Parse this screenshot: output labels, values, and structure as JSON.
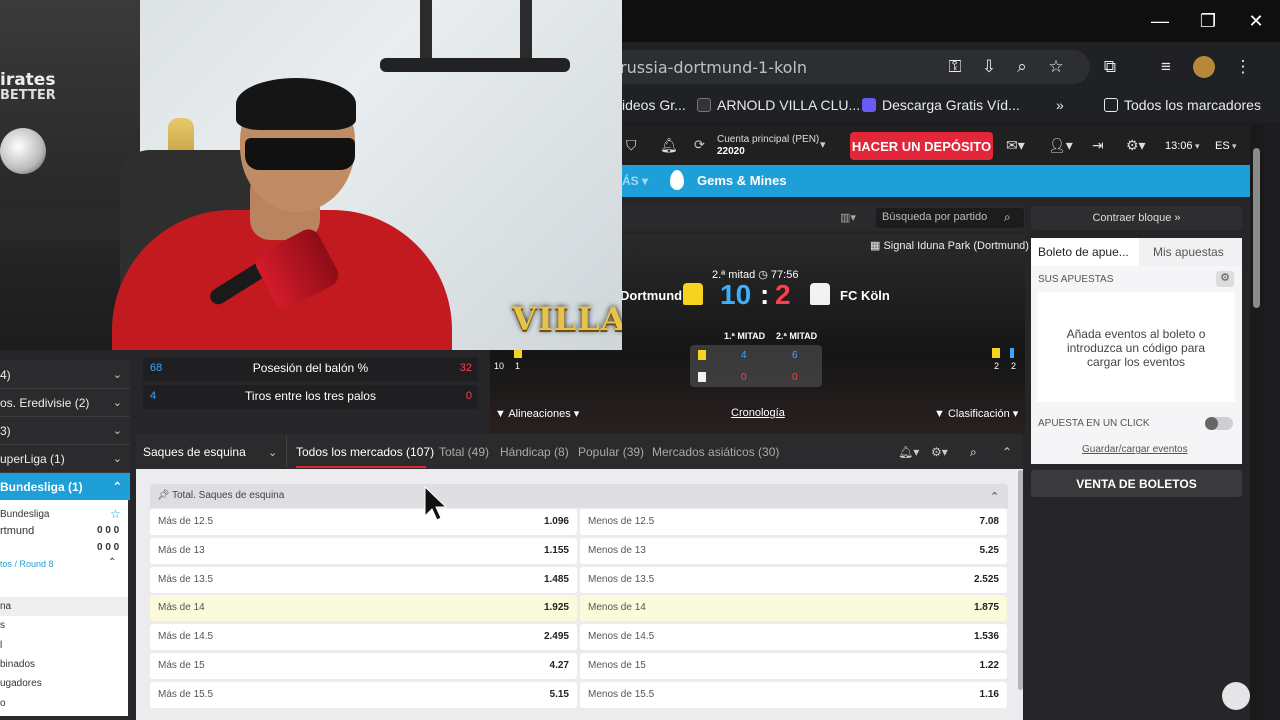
{
  "browser": {
    "url": "russia-dortmund-1-koln",
    "window_controls": [
      "—",
      "❐",
      "✕"
    ],
    "bookmarks": [
      {
        "label": "ideos Gr...",
        "color": "#888"
      },
      {
        "label": "ARNOLD VILLA CLU...",
        "color": "#444"
      },
      {
        "label": "Descarga Gratis Víd...",
        "color": "#6a5af9"
      }
    ],
    "bookmarks_overflow": "»",
    "all_bookmarks": "Todos los marcadores"
  },
  "webcam": {
    "logo": "VILLA",
    "shirt_text_1": "irates",
    "shirt_text_2": "BETTER"
  },
  "header": {
    "account_label": "Cuenta principal (PEN)",
    "account_value": "22020",
    "deposit_button": "HACER UN DEPÓSITO",
    "time": "13:06",
    "language": "ES"
  },
  "nav": {
    "more": "ÁS",
    "gems": "Gems & Mines"
  },
  "match": {
    "search_placeholder": "Búsqueda por partido",
    "stadium": "Signal Iduna Park (Dortmund)",
    "period": "2.ª mitad",
    "clock": "77:56",
    "home_team": "Dortmund",
    "away_team": "FC Köln",
    "home_score": "10",
    "separator": ":",
    "away_score": "2",
    "first_half_label": "1.ª MITAD",
    "second_half_label": "2.ª MITAD",
    "home_first_half": "4",
    "home_second_half": "6",
    "away_first_half": "0",
    "away_second_half": "0",
    "left_card_counts": [
      "10",
      "1"
    ],
    "right_card_counts": [
      "2",
      "2"
    ],
    "links": {
      "lineups": "Alineaciones",
      "timeline": "Cronología",
      "standings": "Clasificación"
    },
    "stats": [
      {
        "home": "68",
        "label": "Posesión del balón %",
        "away": "32"
      },
      {
        "home": "4",
        "label": "Tiros entre los tres palos",
        "away": "0"
      }
    ]
  },
  "sidebar": {
    "items": [
      {
        "label": "4)"
      },
      {
        "label": "os. Eredivisie (2)"
      },
      {
        "label": "3)"
      },
      {
        "label": "uperLiga (1)"
      },
      {
        "label": "Bundesliga (1)"
      }
    ],
    "league": "Bundesliga",
    "team1": "rtmund",
    "team1_score": "0 0 0",
    "team2_score": "0 0 0",
    "round": "tos / Round 8",
    "menu": [
      "na",
      "s",
      "l",
      "binados",
      "ugadores",
      "o"
    ]
  },
  "markets": {
    "selected": "Saques de esquina",
    "tabs": [
      {
        "label": "Todos los mercados (107)"
      },
      {
        "label": "Total (49)"
      },
      {
        "label": "Hándicap (8)"
      },
      {
        "label": "Popular (39)"
      },
      {
        "label": "Mercados asiáticos (30)"
      }
    ],
    "group_title": "Total. Saques de esquina",
    "rows": [
      {
        "over_label": "Más de 12.5",
        "over_odd": "1.096",
        "under_label": "Menos de 12.5",
        "under_odd": "7.08"
      },
      {
        "over_label": "Más de 13",
        "over_odd": "1.155",
        "under_label": "Menos de 13",
        "under_odd": "5.25"
      },
      {
        "over_label": "Más de 13.5",
        "over_odd": "1.485",
        "under_label": "Menos de 13.5",
        "under_odd": "2.525"
      },
      {
        "over_label": "Más de 14",
        "over_odd": "1.925",
        "under_label": "Menos de 14",
        "under_odd": "1.875"
      },
      {
        "over_label": "Más de 14.5",
        "over_odd": "2.495",
        "under_label": "Menos de 14.5",
        "under_odd": "1.536"
      },
      {
        "over_label": "Más de 15",
        "over_odd": "4.27",
        "under_label": "Menos de 15",
        "under_odd": "1.22"
      },
      {
        "over_label": "Más de 15.5",
        "over_odd": "5.15",
        "under_label": "Menos de 15.5",
        "under_odd": "1.16"
      }
    ]
  },
  "betslip": {
    "collapse_button": "Contraer bloque",
    "tab_slip": "Boleto de apue...",
    "tab_my_bets": "Mis apuestas",
    "your_bets": "SUS APUESTAS",
    "empty_message": "Añada eventos al boleto o introduzca un código para cargar los eventos",
    "one_click": "APUESTA EN UN CLICK",
    "save_load": "Guardar/cargar eventos",
    "sell": "VENTA DE BOLETOS"
  }
}
